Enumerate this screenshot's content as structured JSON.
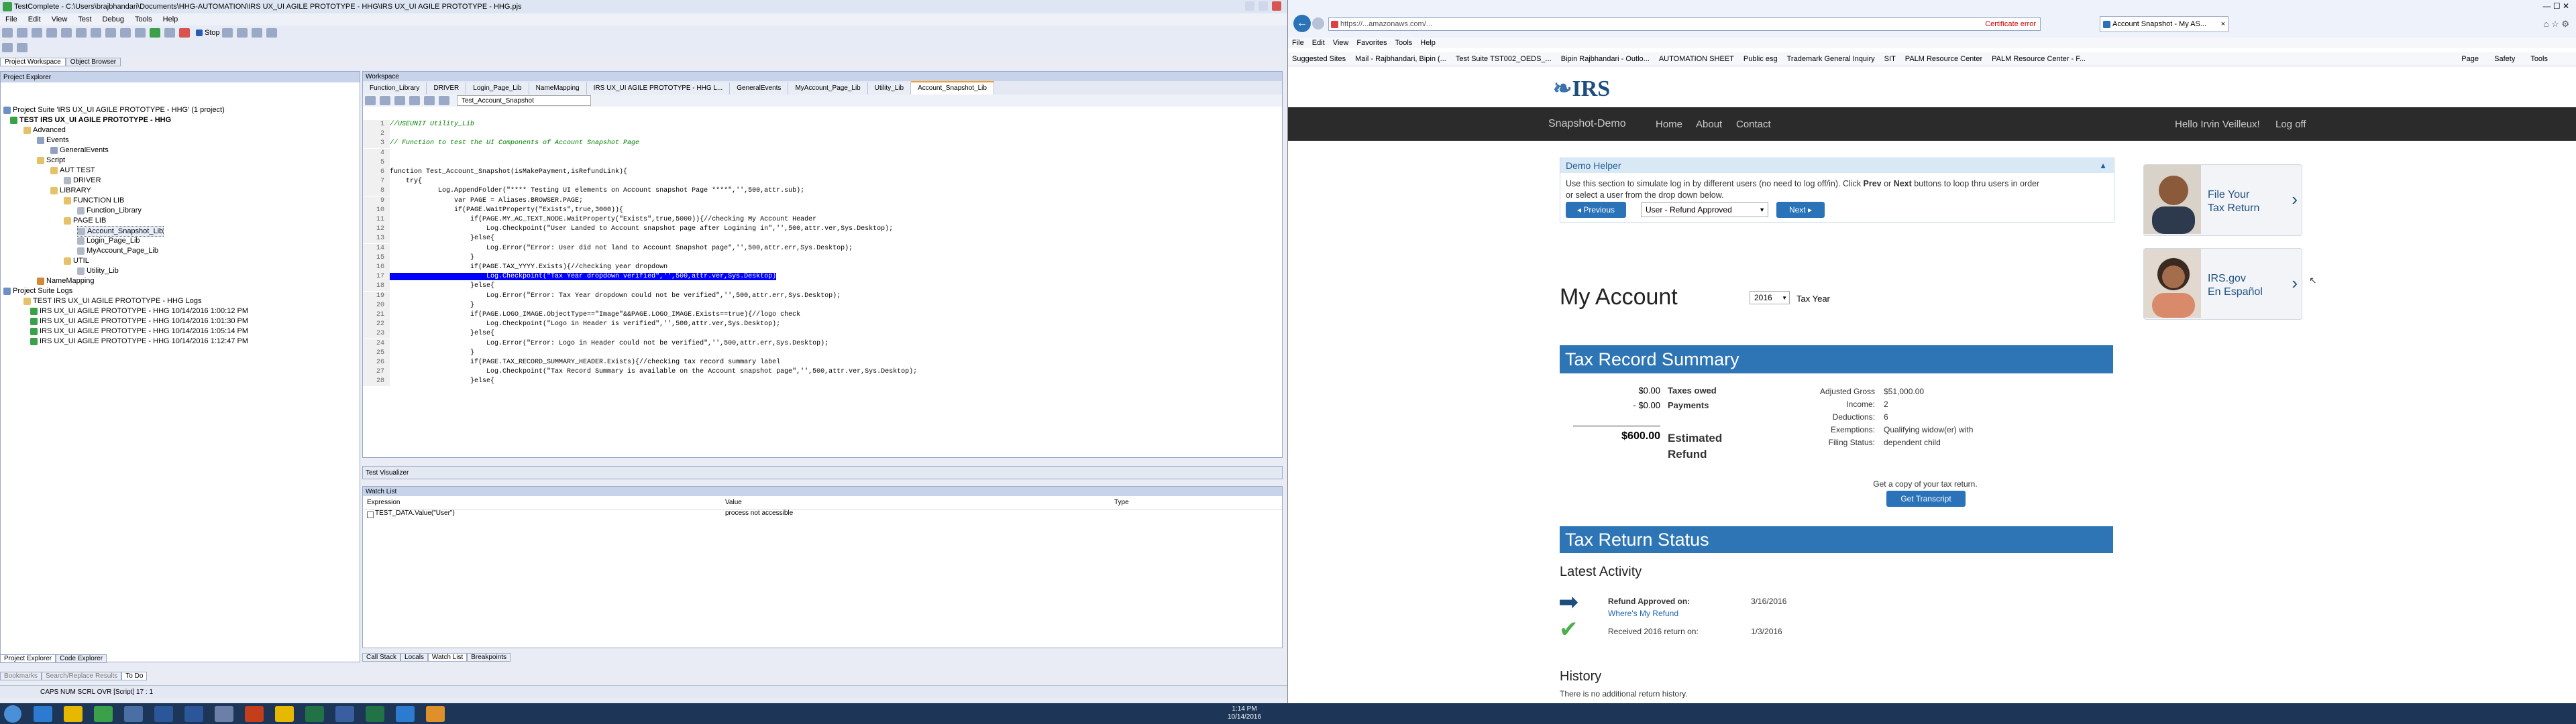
{
  "ide": {
    "title": "TestComplete - C:\\Users\\brajbhandari\\Documents\\HHG-AUTOMATION\\IRS UX_UI AGILE PROTOTYPE - HHG\\IRS UX_UI AGILE PROTOTYPE - HHG.pjs",
    "menu": [
      "File",
      "Edit",
      "View",
      "Test",
      "Debug",
      "Tools",
      "Help"
    ],
    "stop_label": "Stop",
    "ws_tabs": [
      "Project Workspace",
      "Object Browser"
    ],
    "project_explorer": {
      "title": "Project Explorer",
      "items": [
        "Project Suite 'IRS UX_UI AGILE PROTOTYPE - HHG' (1 project)",
        "TEST IRS UX_UI AGILE PROTOTYPE - HHG",
        "Advanced",
        "Events",
        "GeneralEvents",
        "Script",
        "AUT TEST",
        "DRIVER",
        "LIBRARY",
        "FUNCTION LIB",
        "Function_Library",
        "PAGE LIB",
        "Account_Snapshot_Lib",
        "Login_Page_Lib",
        "MyAccount_Page_Lib",
        "UTIL",
        "Utility_Lib",
        "NameMapping",
        "Project Suite Logs",
        "TEST IRS UX_UI AGILE PROTOTYPE - HHG Logs",
        "IRS UX_UI AGILE PROTOTYPE - HHG 10/14/2016 1:00:12 PM",
        "IRS UX_UI AGILE PROTOTYPE - HHG 10/14/2016 1:01:30 PM",
        "IRS UX_UI AGILE PROTOTYPE - HHG 10/14/2016 1:05:14 PM",
        "IRS UX_UI AGILE PROTOTYPE - HHG 10/14/2016 1:12:47 PM"
      ]
    },
    "workspace": {
      "title": "Workspace",
      "tabs": [
        "Function_Library",
        "DRIVER",
        "Login_Page_Lib",
        "NameMapping",
        "IRS UX_UI AGILE PROTOTYPE - HHG L...",
        "GeneralEvents",
        "MyAccount_Page_Lib",
        "Utility_Lib",
        "Account_Snapshot_Lib"
      ],
      "routine": "Test_Account_Snapshot",
      "code_lines": [
        "//USEUNIT Utility_Lib",
        "",
        "// Function to test the UI Components of Account Snapshot Page",
        "",
        "",
        "function Test_Account_Snapshot(isMakePayment,isRefundLink){",
        "    try{",
        "            Log.AppendFolder(\"**** Testing UI elements on Account snapshot Page ****\",'',500,attr.sub);",
        "                var PAGE = Aliases.BROWSER.PAGE;",
        "                if(PAGE.WaitProperty(\"Exists\",true,3000)){",
        "                    if(PAGE.MY_AC_TEXT_NODE.WaitProperty(\"Exists\",true,5000)){//checking My Account Header",
        "                        Log.Checkpoint(\"User Landed to Account snapshot page after Logining in\",'',500,attr.ver,Sys.Desktop);",
        "                    }else{",
        "                        Log.Error(\"Error: User did not land to Account Snapshot page\",'',500,attr.err,Sys.Desktop);",
        "                    }",
        "                    if(PAGE.TAX_YYYY.Exists){//checking year dropdown",
        "                        Log.Checkpoint(\"Tax Year dropdown verified\",'',500,attr.ver,Sys.Desktop)",
        "                    }else{",
        "                        Log.Error(\"Error: Tax Year dropdown could not be verified\",'',500,attr.err,Sys.Desktop);",
        "                    }",
        "                    if(PAGE.LOGO_IMAGE.ObjectType==\"Image\"&&PAGE.LOGO_IMAGE.Exists==true){//logo check",
        "                        Log.Checkpoint(\"Logo in Header is verified\",'',500,attr.ver,Sys.Desktop);",
        "                    }else{",
        "                        Log.Error(\"Error: Logo in Header could not be verified\",'',500,attr.err,Sys.Desktop);",
        "                    }",
        "                    if(PAGE.TAX_RECORD_SUMMARY_HEADER.Exists){//checking tax record summary label",
        "                        Log.Checkpoint(\"Tax Record Summary is available on the Account snapshot page\",'',500,attr.ver,Sys.Desktop);",
        "                    }else{"
      ]
    },
    "test_visualizer": "Test Visualizer",
    "watch_list": {
      "title": "Watch List",
      "cols": [
        "Expression",
        "Value",
        "Type"
      ],
      "row": {
        "expr": "TEST_DATA.Value(\"User\")",
        "value": "process not accessible",
        "type": ""
      }
    },
    "bottom_tabs": [
      "Call Stack",
      "Locals",
      "Watch List",
      "Breakpoints"
    ],
    "left_bottom_tabs": [
      "Project Explorer",
      "Code Explorer"
    ],
    "left_bottom_tabs2": [
      "Bookmarks",
      "Search/Replace Results",
      "To Do"
    ],
    "status": "CAPS  NUM  SCRL  OVR  [Script]  17 : 1"
  },
  "browser": {
    "address": "https://...amazonaws.com/...",
    "cert_error": "Certificate error",
    "tab_title": "Account Snapshot - My AS...",
    "menu": [
      "File",
      "Edit",
      "View",
      "Favorites",
      "Tools",
      "Help"
    ],
    "favorites": [
      "Suggested Sites",
      "Mail - Rajbhandari, Bipin (...",
      "Test Suite TST002_OEDS_...",
      "Bipin Rajbhandari - Outlo...",
      "AUTOMATION SHEET",
      "Public esg",
      "Trademark General Inquiry",
      "SIT",
      "PALM Resource Center",
      "PALM Resource Center - F..."
    ],
    "toolbar_right": [
      "Page",
      "Safety",
      "Tools"
    ]
  },
  "irs": {
    "logo": "IRS",
    "nav": {
      "brand": "Snapshot-Demo",
      "links": [
        "Home",
        "About",
        "Contact"
      ],
      "user": "Hello Irvin Veilleux!",
      "logout": "Log off"
    },
    "demo": {
      "title": "Demo Helper",
      "text_1": "Use this section to simulate log in by different users (no need to log off/in). Click ",
      "prev_word": "Prev",
      "or_word": " or ",
      "next_word": "Next",
      "text_2": " buttons to loop thru users in order",
      "text_3": "or select a user from the drop down below.",
      "previous_btn": "Previous",
      "user_select": "User - Refund Approved",
      "next_btn": "Next"
    },
    "account": {
      "title": "My Account",
      "year": "2016",
      "tax_year_label": "Tax Year"
    },
    "summary": {
      "title": "Tax Record Summary",
      "owed_amount": "$0.00",
      "owed_label": "Taxes owed",
      "payments_amount": "- $0.00",
      "payments_label": "Payments",
      "refund_amount": "$600.00",
      "refund_label_1": "Estimated",
      "refund_label_2": "Refund",
      "details": [
        {
          "k": "Adjusted Gross Income:",
          "v": "$51,000.00"
        },
        {
          "k": "Deductions:",
          "v": "2"
        },
        {
          "k": "Exemptions:",
          "v": "6"
        },
        {
          "k": "Filing Status:",
          "v": "Qualifying widow(er) with dependent child"
        }
      ],
      "transcript_prompt": "Get a copy of your tax return.",
      "transcript_btn": "Get Transcript"
    },
    "status": {
      "title": "Tax Return Status",
      "latest": "Latest Activity",
      "approved": "Refund Approved on:",
      "approved_date": "3/16/2016",
      "where": "Where's My Refund",
      "received": "Received 2016 return on:",
      "received_date": "1/3/2016"
    },
    "history": {
      "title": "History",
      "text": "There is no additional return history."
    },
    "side_cards": [
      {
        "line1": "File Your",
        "line2": "Tax Return"
      },
      {
        "line1": "IRS.gov",
        "line2": "En Español"
      }
    ]
  },
  "taskbar": {
    "time": "1:14 PM",
    "date": "10/14/2016"
  }
}
